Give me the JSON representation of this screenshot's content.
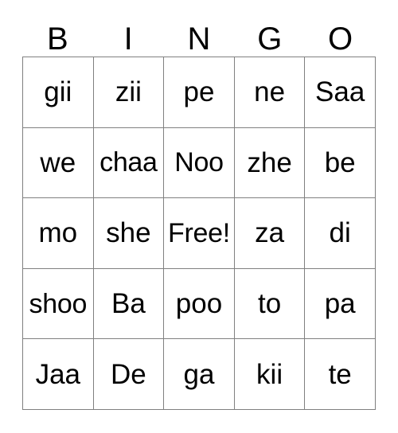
{
  "card": {
    "type": "bingo-card",
    "headers": [
      "B",
      "I",
      "N",
      "G",
      "O"
    ],
    "free_space_label": "Free!",
    "free_space_position": {
      "row": 2,
      "col": 2
    },
    "grid": [
      [
        "gii",
        "zii",
        "pe",
        "ne",
        "Saa"
      ],
      [
        "we",
        "chaa",
        "Noo",
        "zhe",
        "be"
      ],
      [
        "mo",
        "she",
        "Free!",
        "za",
        "di"
      ],
      [
        "shoo",
        "Ba",
        "poo",
        "to",
        "pa"
      ],
      [
        "Jaa",
        "De",
        "ga",
        "kii",
        "te"
      ]
    ],
    "colors": {
      "background": "#ffffff",
      "text": "#000000",
      "border": "#808080"
    }
  }
}
